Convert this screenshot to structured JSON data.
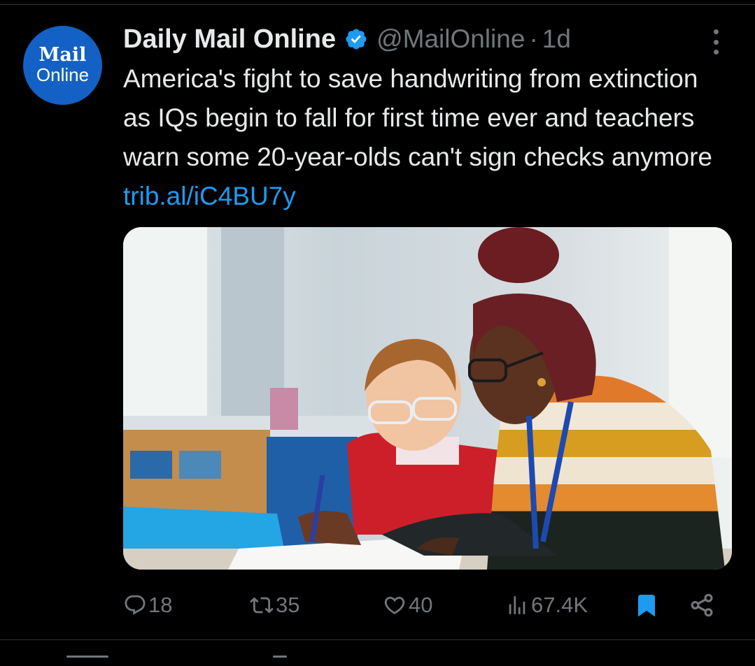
{
  "tweet": {
    "avatar": {
      "line1": "Mail",
      "line2": "Online"
    },
    "author_name": "Daily Mail Online",
    "handle": "@MailOnline",
    "separator": "·",
    "time": "1d",
    "text": "America's fight to save handwriting from extinction as IQs begin to fall for first time ever and teachers warn some 20-year-olds can't sign checks anymore",
    "link": "trib.al/iC4BU7y",
    "icons": {
      "verified": "verified-badge-icon",
      "more": "more-options-icon",
      "reply": "reply-icon",
      "retweet": "retweet-icon",
      "like": "like-icon",
      "views": "views-icon",
      "bookmark": "bookmark-icon",
      "share": "share-icon"
    },
    "colors": {
      "accent": "#1d9bf0",
      "muted": "#71767b",
      "text": "#e7e9ea",
      "avatar_bg": "#1361c4"
    },
    "metrics": {
      "replies": "18",
      "retweets": "35",
      "likes": "40",
      "views": "67.4K"
    },
    "bookmarked": true
  }
}
